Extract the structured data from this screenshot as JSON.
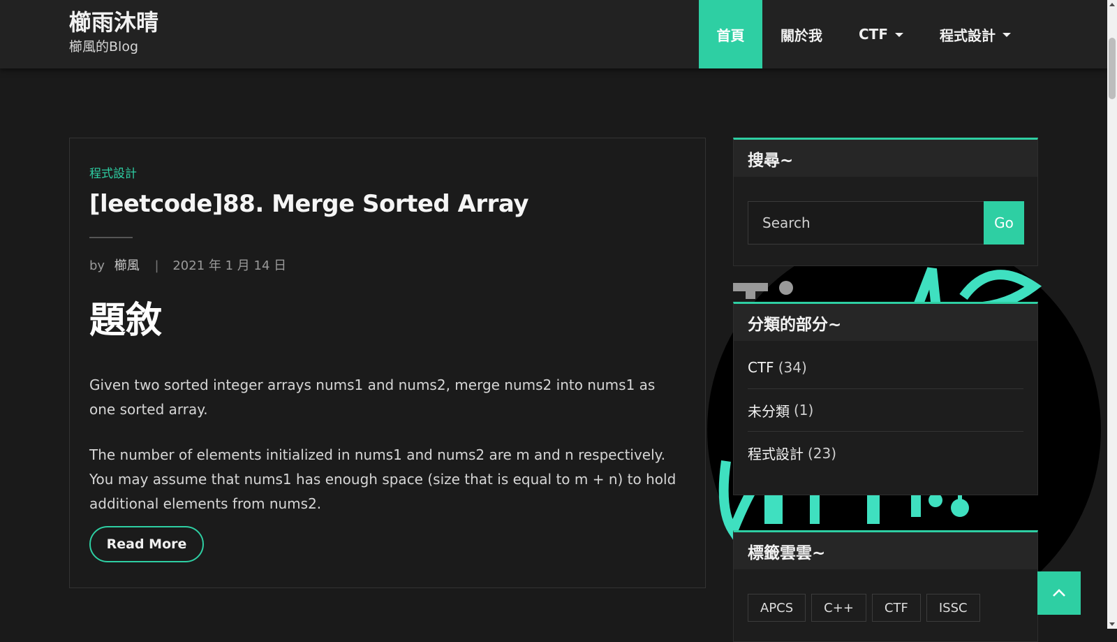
{
  "site": {
    "title": "櫛雨沐晴",
    "description": "櫛風的Blog"
  },
  "nav": {
    "items": [
      {
        "label": "首頁",
        "active": true,
        "dropdown": false
      },
      {
        "label": "關於我",
        "active": false,
        "dropdown": false
      },
      {
        "label": "CTF",
        "active": false,
        "dropdown": true
      },
      {
        "label": "程式設計",
        "active": false,
        "dropdown": true
      }
    ]
  },
  "post": {
    "category": "程式設計",
    "title": "[leetcode]88. Merge Sorted Array",
    "by_label": "by",
    "author": "櫛風",
    "separator": "|",
    "date": "2021 年 1 月 14 日",
    "heading": "題敘",
    "paragraph1": "Given two sorted integer arrays nums1 and nums2, merge nums2 into nums1 as one sorted array.",
    "paragraph2": "The number of elements initialized in nums1 and nums2 are m and n respectively. You may assume that nums1 has enough space (size that is equal to m + n) to hold additional elements from nums2.",
    "read_more": "Read More"
  },
  "sidebar": {
    "search": {
      "title": "搜尋~",
      "placeholder": "Search",
      "button": "Go"
    },
    "categories": {
      "title": "分類的部分~",
      "items": [
        {
          "name": "CTF",
          "count": "(34)"
        },
        {
          "name": "未分類",
          "count": "(1)"
        },
        {
          "name": "程式設計",
          "count": "(23)"
        }
      ]
    },
    "tags": {
      "title": "標籤雲雲~",
      "items": [
        "APCS",
        "C++",
        "CTF",
        "ISSC"
      ]
    }
  },
  "colors": {
    "accent": "#2ecfa3",
    "background": "#1a1a1a",
    "header": "#222222"
  },
  "icons": {
    "back_to_top": "chevron-up-icon",
    "dropdown": "caret-down-icon"
  }
}
